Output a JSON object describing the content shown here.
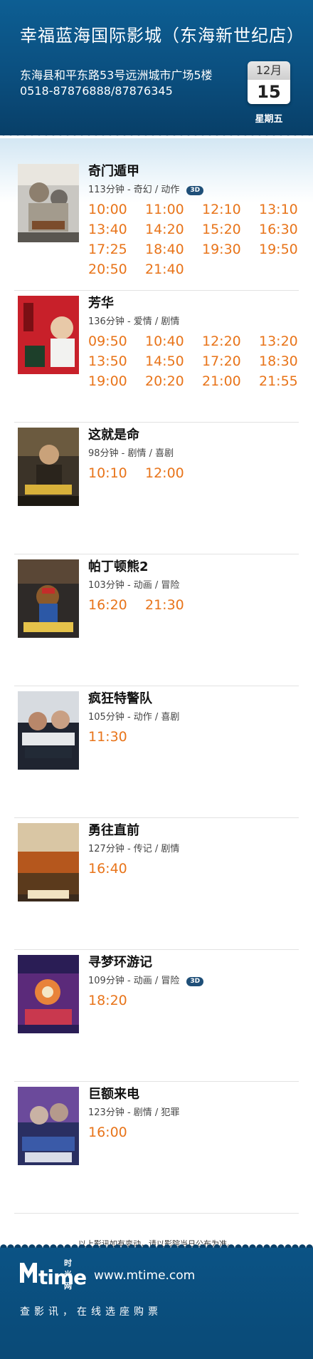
{
  "cinema": {
    "title": "幸福蓝海国际影城（东海新世纪店）",
    "address": "东海县和平东路53号远洲城市广场5楼",
    "phone": "0518-87876888/87876345",
    "date_month": "12月",
    "date_day": "15",
    "weekday": "星期五"
  },
  "movies": [
    {
      "name": "奇门遁甲",
      "meta": "113分钟 - 奇幻 / 动作",
      "is_3d": true,
      "badge": "3D",
      "times": [
        "10:00",
        "11:00",
        "12:10",
        "13:10",
        "13:40",
        "14:20",
        "15:20",
        "16:30",
        "17:25",
        "18:40",
        "19:30",
        "19:50",
        "20:50",
        "21:40"
      ]
    },
    {
      "name": "芳华",
      "meta": "136分钟 - 爱情 / 剧情",
      "is_3d": false,
      "times": [
        "09:50",
        "10:40",
        "12:20",
        "13:20",
        "13:50",
        "14:50",
        "17:20",
        "18:30",
        "19:00",
        "20:20",
        "21:00",
        "21:55"
      ]
    },
    {
      "name": "这就是命",
      "meta": "98分钟 - 剧情 / 喜剧",
      "is_3d": false,
      "times": [
        "10:10",
        "12:00"
      ]
    },
    {
      "name": "帕丁顿熊2",
      "meta": "103分钟 - 动画 / 冒险",
      "is_3d": false,
      "times": [
        "16:20",
        "21:30"
      ]
    },
    {
      "name": "疯狂特警队",
      "meta": "105分钟 - 动作 / 喜剧",
      "is_3d": false,
      "times": [
        "11:30"
      ]
    },
    {
      "name": "勇往直前",
      "meta": "127分钟 - 传记 / 剧情",
      "is_3d": false,
      "times": [
        "16:40"
      ]
    },
    {
      "name": "寻梦环游记",
      "meta": "109分钟 - 动画 / 冒险",
      "is_3d": true,
      "badge": "3D",
      "times": [
        "18:20"
      ]
    },
    {
      "name": "巨额来电",
      "meta": "123分钟 - 剧情 / 犯罪",
      "is_3d": false,
      "times": [
        "16:00"
      ]
    }
  ],
  "footer": {
    "notice": "以上影讯如有变动，请以影院当日公布为准。",
    "logo_cn": "时光网",
    "logo_text": "time",
    "site": "www.mtime.com",
    "slogan": "查影讯，在线选座购票"
  },
  "colors": {
    "header_blue": "#0b4f7f",
    "showtime_orange": "#e8741a",
    "badge_3d": "#1f4f78"
  }
}
